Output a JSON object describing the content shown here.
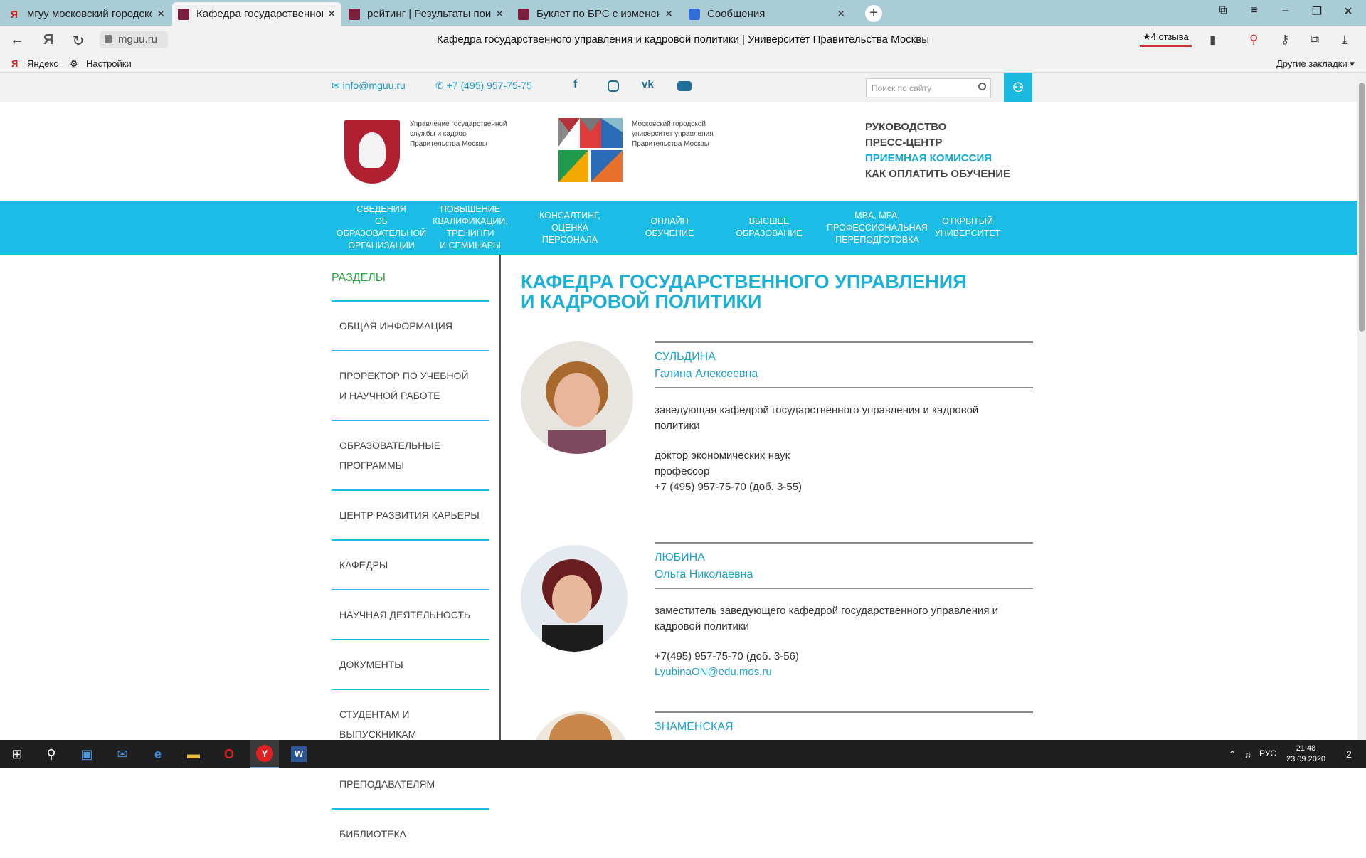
{
  "browser": {
    "tabs": [
      {
        "title": "мгуу московский городской",
        "icon": "yandex-icon"
      },
      {
        "title": "Кафедра государственного",
        "icon": "mguu-icon",
        "active": true
      },
      {
        "title": "рейтинг | Результаты поиск",
        "icon": "mguu-icon"
      },
      {
        "title": "Буклет по БРС с изменения",
        "icon": "mguu-icon"
      },
      {
        "title": "Сообщения",
        "icon": "messages-icon"
      }
    ],
    "new_tab": "+",
    "url": "mguu.ru",
    "page_title": "Кафедра государственного управления и кадровой политики | Университет Правительства Москвы",
    "reviews": "★4 отзыва",
    "bookmarks": {
      "yandex": "Яндекс",
      "settings": "Настройки",
      "other": "Другие закладки ▾"
    }
  },
  "site": {
    "email": "info@mguu.ru",
    "phone": "+7 (495) 957-75-75",
    "search_placeholder": "Поиск по сайту",
    "logo1_text": [
      "Управление государственной",
      "службы и кадров",
      "Правительства Москвы"
    ],
    "logo2_text": [
      "Московский городской",
      "университет управления",
      "Правительства Москвы"
    ],
    "top_links": [
      "РУКОВОДСТВО",
      "ПРЕСС-ЦЕНТР",
      "ПРИЕМНАЯ КОМИССИЯ",
      "КАК ОПЛАТИТЬ ОБУЧЕНИЕ"
    ],
    "nav": [
      [
        "СВЕДЕНИЯ",
        "ОБ ОБРАЗОВАТЕЛЬНОЙ",
        "ОРГАНИЗАЦИИ"
      ],
      [
        "ПОВЫШЕНИЕ",
        "КВАЛИФИКАЦИИ,",
        "ТРЕНИНГИ",
        "И СЕМИНАРЫ"
      ],
      [
        "КОНСАЛТИНГ,",
        "ОЦЕНКА",
        "ПЕРСОНАЛА"
      ],
      [
        "ОНЛАЙН",
        "ОБУЧЕНИЕ"
      ],
      [
        "ВЫСШЕЕ",
        "ОБРАЗОВАНИЕ"
      ],
      [
        "MBA, MPA,",
        "ПРОФЕССИОНАЛЬНАЯ",
        "ПЕРЕПОДГОТОВКА"
      ],
      [
        "ОТКРЫТЫЙ",
        "УНИВЕРСИТЕТ"
      ]
    ],
    "sidebar_title": "РАЗДЕЛЫ",
    "sidebar": [
      [
        "ОБЩАЯ ИНФОРМАЦИЯ"
      ],
      [
        "ПРОРЕКТОР ПО УЧЕБНОЙ",
        "И НАУЧНОЙ РАБОТЕ"
      ],
      [
        "ОБРАЗОВАТЕЛЬНЫЕ",
        "ПРОГРАММЫ"
      ],
      [
        "ЦЕНТР РАЗВИТИЯ КАРЬЕРЫ"
      ],
      [
        "КАФЕДРЫ"
      ],
      [
        "НАУЧНАЯ ДЕЯТЕЛЬНОСТЬ"
      ],
      [
        "ДОКУМЕНТЫ"
      ],
      [
        "СТУДЕНТАМ И ВЫПУСКНИКАМ"
      ],
      [
        "ПРЕПОДАВАТЕЛЯМ"
      ],
      [
        "БИБЛИОТЕКА"
      ]
    ],
    "main_title": [
      "КАФЕДРА ГОСУДАРСТВЕННОГО УПРАВЛЕНИЯ",
      "И КАДРОВОЙ ПОЛИТИКИ"
    ],
    "people": [
      {
        "surname": "СУЛЬДИНА",
        "name": "Галина Алексеевна",
        "position": "заведующая кафедрой государственного управления и кадровой политики",
        "degree": "доктор экономических наук",
        "rank": "профессор",
        "phone": "+7 (495) 957-75-70 (доб. 3-55)"
      },
      {
        "surname": "ЛЮБИНА",
        "name": "Ольга Николаевна",
        "position": "заместитель заведующего кафедрой государственного управления и кадровой политики",
        "phone": "+7(495) 957-75-70 (доб. 3-56)",
        "email": "LyubinaON@edu.mos.ru"
      },
      {
        "surname": "ЗНАМЕНСКАЯ"
      }
    ]
  },
  "taskbar": {
    "lang": "РУС",
    "time": "21:48",
    "date": "23.09.2020",
    "notifications": "2"
  },
  "colors": {
    "accent": "#1bbde6",
    "link": "#1aa3cd",
    "green": "#27a844",
    "tabbar": "#a9ccd6"
  }
}
